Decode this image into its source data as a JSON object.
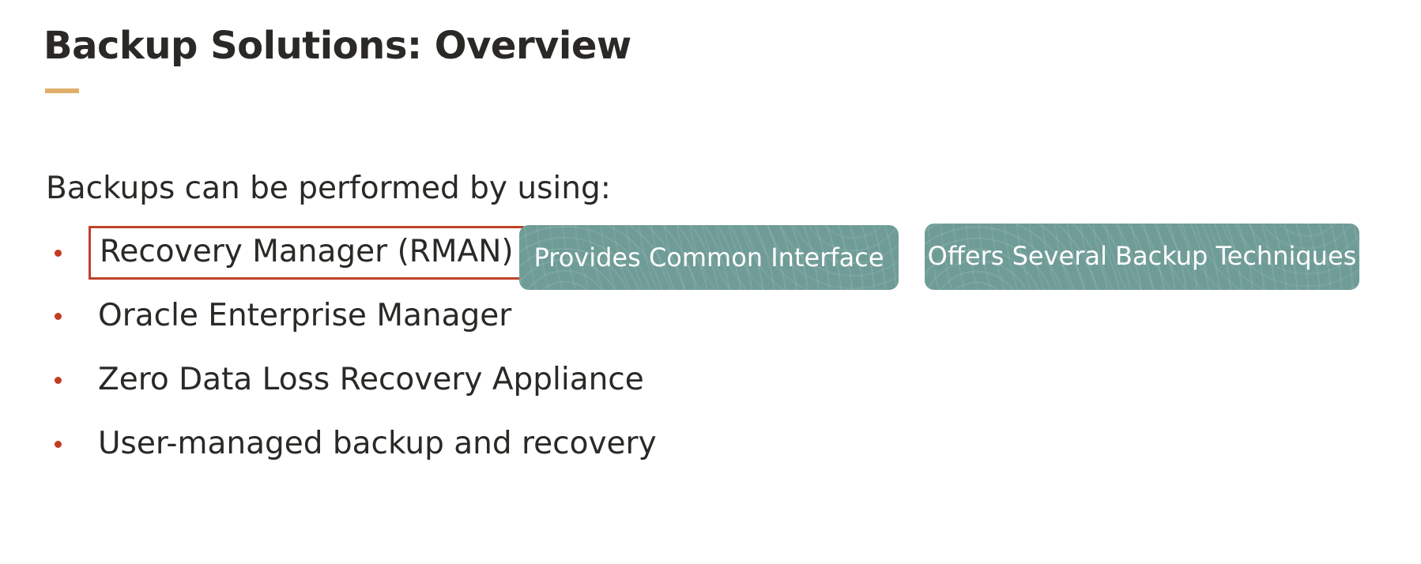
{
  "slide": {
    "title": "Backup Solutions: Overview",
    "accent_color": "#e0ae6b",
    "intro": "Backups can be performed by using:",
    "bullet_color": "#c23b22",
    "highlight_color": "#c0412a",
    "bullets": [
      {
        "label": "Recovery Manager (RMAN)",
        "highlighted": true
      },
      {
        "label": "Oracle Enterprise Manager",
        "highlighted": false
      },
      {
        "label": "Zero Data Loss Recovery Appliance",
        "highlighted": false
      },
      {
        "label": "User-managed backup and recovery",
        "highlighted": false
      }
    ],
    "pill_color": "#6f9c97",
    "pills": [
      {
        "label": "Provides Common Interface"
      },
      {
        "label": "Offers Several Backup Techniques"
      }
    ]
  }
}
